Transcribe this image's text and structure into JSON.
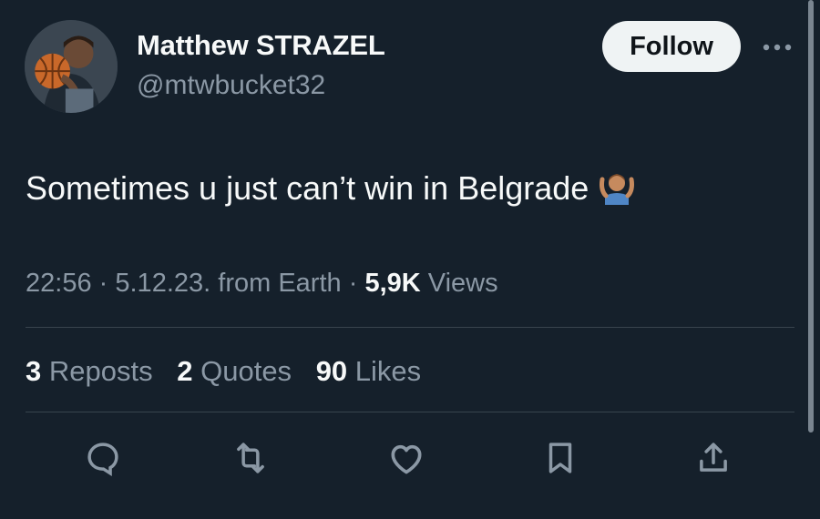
{
  "user": {
    "display_name": "Matthew STRAZEL",
    "handle": "@mtwbucket32",
    "follow_label": "Follow"
  },
  "tweet": {
    "text": "Sometimes u just can’t win in Belgrade",
    "emoji": "person-shrugging"
  },
  "meta": {
    "time": "22:56",
    "date": "5.12.23.",
    "source": "from Earth",
    "views_count": "5,9K",
    "views_label": "Views"
  },
  "stats": {
    "reposts_count": "3",
    "reposts_label": "Reposts",
    "quotes_count": "2",
    "quotes_label": "Quotes",
    "likes_count": "90",
    "likes_label": "Likes"
  },
  "actions": [
    "reply-icon",
    "repost-icon",
    "like-icon",
    "bookmark-icon",
    "share-icon"
  ],
  "colors": {
    "background": "#15202b",
    "text": "#f7f9f9",
    "secondary": "#8b98a5",
    "button": "#eff3f4",
    "divider": "#38444d"
  }
}
